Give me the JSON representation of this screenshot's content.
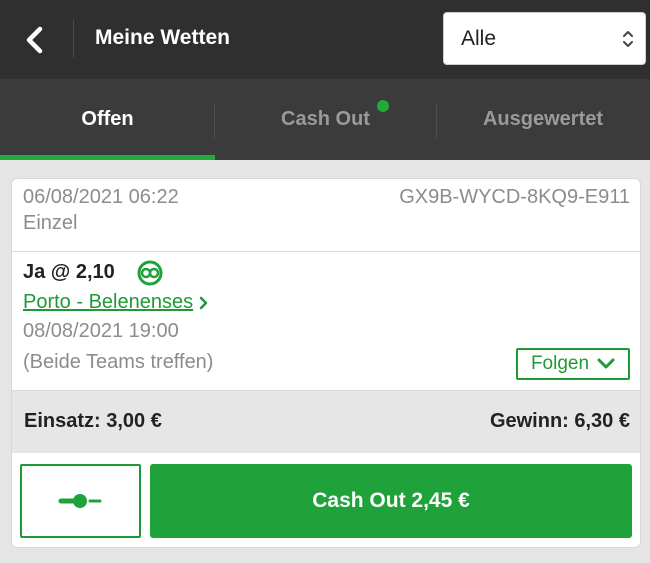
{
  "header": {
    "title": "Meine Wetten",
    "filter": {
      "selected": "Alle"
    }
  },
  "tabs": [
    {
      "label": "Offen",
      "active": true
    },
    {
      "label": "Cash Out",
      "has_notification": true
    },
    {
      "label": "Ausgewertet"
    }
  ],
  "bet": {
    "placed_at": "06/08/2021 06:22",
    "id": "GX9B-WYCD-8KQ9-E911",
    "type": "Einzel",
    "pick": "Ja @ 2,10",
    "event": "Porto - Belenenses",
    "event_date": "08/08/2021 19:00",
    "market": "(Beide Teams treffen)",
    "follow_label": "Folgen",
    "stake": "Einsatz: 3,00 €",
    "winnings": "Gewinn: 6,30 €",
    "cashout_label": "Cash Out 2,45 €"
  },
  "colors": {
    "accent": "#1fa23a",
    "header_bg": "#2f2f2f",
    "tabs_bg": "#3b3b3b"
  },
  "icons": [
    "back-arrow-icon",
    "select-arrows-icon",
    "cashout-available-icon",
    "chevron-right-icon",
    "chevron-down-icon",
    "slider-icon"
  ]
}
